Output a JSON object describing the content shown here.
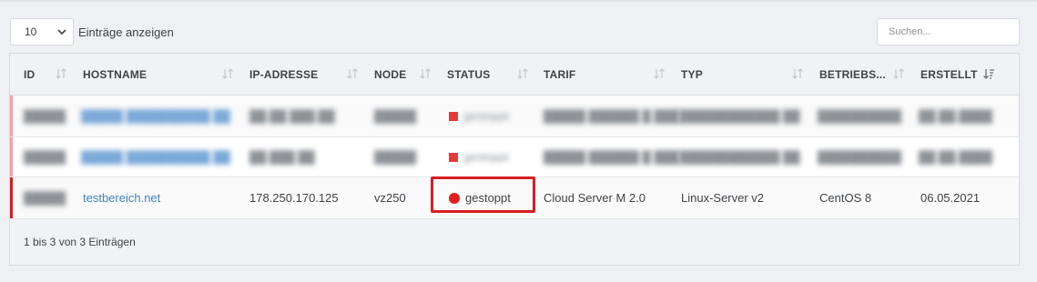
{
  "length_select": {
    "value": "10"
  },
  "show_label": "Einträge anzeigen",
  "search": {
    "placeholder": "Suchen..."
  },
  "columns": [
    {
      "key": "id",
      "label": "ID",
      "sort": "none"
    },
    {
      "key": "hostname",
      "label": "HOSTNAME",
      "sort": "none"
    },
    {
      "key": "ip",
      "label": "IP-ADRESSE",
      "sort": "none"
    },
    {
      "key": "node",
      "label": "NODE",
      "sort": "none"
    },
    {
      "key": "status",
      "label": "STATUS",
      "sort": "none"
    },
    {
      "key": "tarif",
      "label": "TARIF",
      "sort": "none"
    },
    {
      "key": "typ",
      "label": "TYP",
      "sort": "none"
    },
    {
      "key": "os",
      "label": "BETRIEBS...",
      "sort": "none"
    },
    {
      "key": "created",
      "label": "ERSTELLT",
      "sort": "desc"
    }
  ],
  "rows": [
    {
      "redacted": true,
      "id": "",
      "hostname": "",
      "ip": "",
      "node": "",
      "status": "gestoppt",
      "tarif": "",
      "typ": "",
      "os": "",
      "created": ""
    },
    {
      "redacted": true,
      "id": "",
      "hostname": "",
      "ip": "",
      "node": "",
      "status": "gestoppt",
      "tarif": "",
      "typ": "",
      "os": "",
      "created": ""
    },
    {
      "redacted": false,
      "id": "",
      "hostname": "testbereich.net",
      "ip": "178.250.170.125",
      "node": "vz250",
      "status": "gestoppt",
      "tarif": "Cloud Server M 2.0",
      "typ": "Linux-Server v2",
      "os": "CentOS 8",
      "created": "06.05.2021"
    }
  ],
  "footer": "1 bis 3 von 3 Einträgen",
  "colors": {
    "status_stopped": "#e41e1e",
    "row_marker": "#d81e26",
    "highlight": "#d81e26",
    "link": "#3f83c4"
  }
}
